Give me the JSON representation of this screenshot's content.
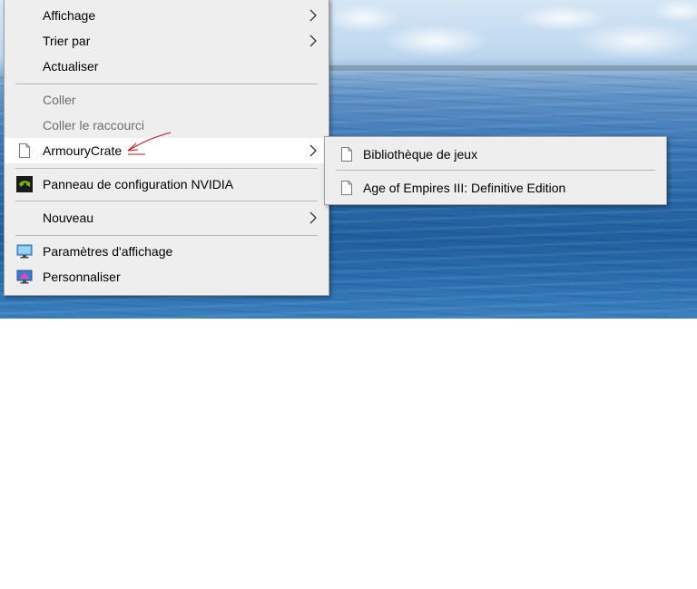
{
  "context_menu": {
    "items": [
      {
        "label": "Affichage",
        "has_submenu": true
      },
      {
        "label": "Trier par",
        "has_submenu": true
      },
      {
        "label": "Actualiser"
      },
      {
        "label": "Coller",
        "disabled": true
      },
      {
        "label": "Coller le raccourci",
        "disabled": true
      },
      {
        "label": "ArmouryCrate",
        "has_submenu": true,
        "highlighted": true,
        "icon": "file-icon"
      },
      {
        "label": "Panneau de configuration NVIDIA",
        "icon": "nvidia-icon"
      },
      {
        "label": "Nouveau",
        "has_submenu": true
      },
      {
        "label": "Paramètres d'affichage",
        "icon": "display-settings-icon"
      },
      {
        "label": "Personnaliser",
        "icon": "personalize-icon"
      }
    ]
  },
  "submenu": {
    "items": [
      {
        "label": "Bibliothèque de jeux",
        "icon": "file-icon"
      },
      {
        "label": "Age of Empires III: Definitive Edition",
        "icon": "file-icon"
      }
    ]
  },
  "colors": {
    "menu_background": "#eeeeee",
    "highlight": "#ffffff",
    "disabled_text": "#6d6d6d",
    "annotation": "#d0121b",
    "nvidia_green": "#76b900"
  }
}
